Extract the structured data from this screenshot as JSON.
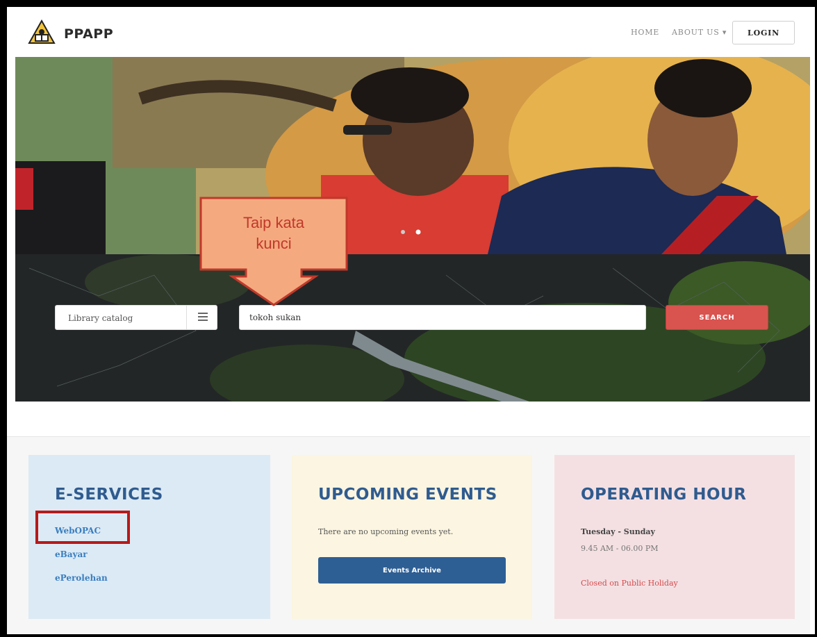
{
  "header": {
    "brand": "PPAPP",
    "nav": {
      "home": "HOME",
      "about": "ABOUT US ▾",
      "login": "LOGIN"
    }
  },
  "annotation": {
    "line1": "Taip kata",
    "line2": "kunci"
  },
  "search": {
    "catalog_value": "Library catalog",
    "query_value": "tokoh sukan",
    "button_label": "SEARCH"
  },
  "cards": {
    "eservices": {
      "title": "E-SERVICES",
      "links": [
        "WebOPAC",
        "eBayar",
        "ePerolehan"
      ]
    },
    "events": {
      "title": "UPCOMING EVENTS",
      "message": "There are no upcoming events yet.",
      "button_label": "Events Archive"
    },
    "hours": {
      "title": "OPERATING HOUR",
      "days": "Tuesday - Sunday",
      "time": "9.45 AM - 06.00 PM",
      "note": "Closed on Public Holiday"
    }
  },
  "colors": {
    "accent_red": "#d9534f",
    "primary_blue": "#2e5f94",
    "title_blue": "#2f5b8f",
    "annotation_orange": "#f5a97f",
    "annotation_border": "#c0392b"
  },
  "icons": [
    "logo-icon",
    "menu-icon",
    "carousel-dots"
  ]
}
